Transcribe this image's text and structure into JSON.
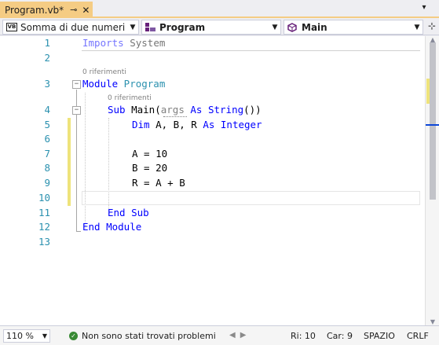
{
  "tab": {
    "title": "Program.vb*",
    "pin_icon": "pin-icon",
    "close_icon": "close-icon"
  },
  "navbar": {
    "project": {
      "badge": "VB",
      "label": "Somma di due numeri"
    },
    "class": {
      "label": "Program"
    },
    "member": {
      "label": "Main"
    }
  },
  "lens": {
    "refs_module": "0 riferimenti",
    "refs_sub": "0 riferimenti"
  },
  "lines": {
    "n1": "1",
    "n2": "2",
    "n3": "3",
    "n4": "4",
    "n5": "5",
    "n6": "6",
    "n7": "7",
    "n8": "8",
    "n9": "9",
    "n10": "10",
    "n11": "11",
    "n12": "12",
    "n13": "13"
  },
  "code": {
    "l1_kw": "Imports",
    "l1_ns": " System",
    "l3_kw": "Module",
    "l3_name": " Program",
    "l4_kw": "Sub",
    "l4_name": " Main",
    "l4_open": "(",
    "l4_param": "args",
    "l4_as": " As",
    "l4_type": " String",
    "l4_close": "())",
    "l5_kw": "Dim",
    "l5_vars": " A, B, R ",
    "l5_as": "As",
    "l5_type": " Integer",
    "l7": "A = 10",
    "l8": "B = 20",
    "l9": "R = A + B",
    "l11": "End Sub",
    "l12": "End Module"
  },
  "status": {
    "zoom": "110 %",
    "problems": "Non sono stati trovati problemi",
    "row": "Ri: 10",
    "col": "Car: 9",
    "indent": "SPAZIO",
    "eol": "CRLF"
  },
  "colors": {
    "tab_active": "#f5cc84",
    "line_number": "#2b91af",
    "keyword": "#0000ff",
    "change_bar": "#eee37b"
  }
}
